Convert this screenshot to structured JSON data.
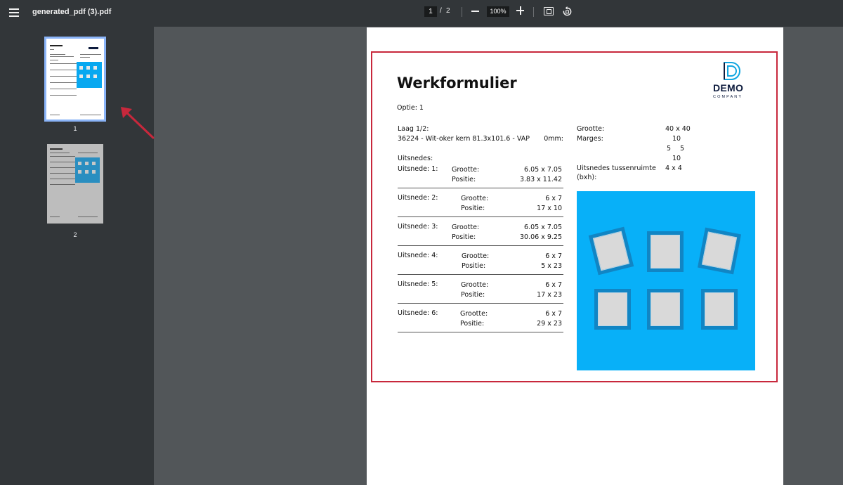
{
  "toolbar": {
    "file_name": "generated_pdf (3).pdf",
    "current_page": "1",
    "page_separator": "/",
    "total_pages": "2",
    "zoom": "100%"
  },
  "sidebar": {
    "thumbnails": [
      {
        "label": "1",
        "selected": true
      },
      {
        "label": "2",
        "selected": false
      }
    ]
  },
  "document": {
    "title": "Werkformulier",
    "option": "Optie: 1",
    "layer_label": "Laag 1/2:",
    "layer_material": "36224 - Wit-oker kern 81.3x101.6 - VAP",
    "layer_thickness": "0mm:",
    "cutouts_header": "Uitsnedes:",
    "size_label": "Grootte:",
    "position_label": "Positie:",
    "cutouts": [
      {
        "name": "Uitsnede: 1:",
        "size": "6.05 x 7.05",
        "position": "3.83 x 11.42"
      },
      {
        "name": "Uitsnede: 2:",
        "size": "6 x 7",
        "position": "17 x 10"
      },
      {
        "name": "Uitsnede: 3:",
        "size": "6.05 x 7.05",
        "position": "30.06 x 9.25"
      },
      {
        "name": "Uitsnede: 4:",
        "size": "6 x 7",
        "position": "5 x 23"
      },
      {
        "name": "Uitsnede: 5:",
        "size": "6 x 7",
        "position": "17 x 23"
      },
      {
        "name": "Uitsnede: 6:",
        "size": "6 x 7",
        "position": "29 x 23"
      }
    ],
    "specs": {
      "size_label": "Grootte:",
      "size_value": "40 x 40",
      "margins_label": "Marges:",
      "margin_top": "10",
      "margin_left": "5",
      "margin_right": "5",
      "margin_bottom": "10",
      "spacing_label_line1": "Uitsnedes tussenruimte",
      "spacing_label_line2": "(bxh):",
      "spacing_value": "4 x 4"
    },
    "logo": {
      "word": "DEMO",
      "sub": "COMPANY"
    },
    "colors": {
      "panel": "#08b0f8",
      "piece_border": "#1185c4",
      "piece_fill": "#d9d9d9",
      "highlight": "#c8283c",
      "logo_navy": "#0d1b3d",
      "logo_cyan": "#12a6e0"
    }
  }
}
